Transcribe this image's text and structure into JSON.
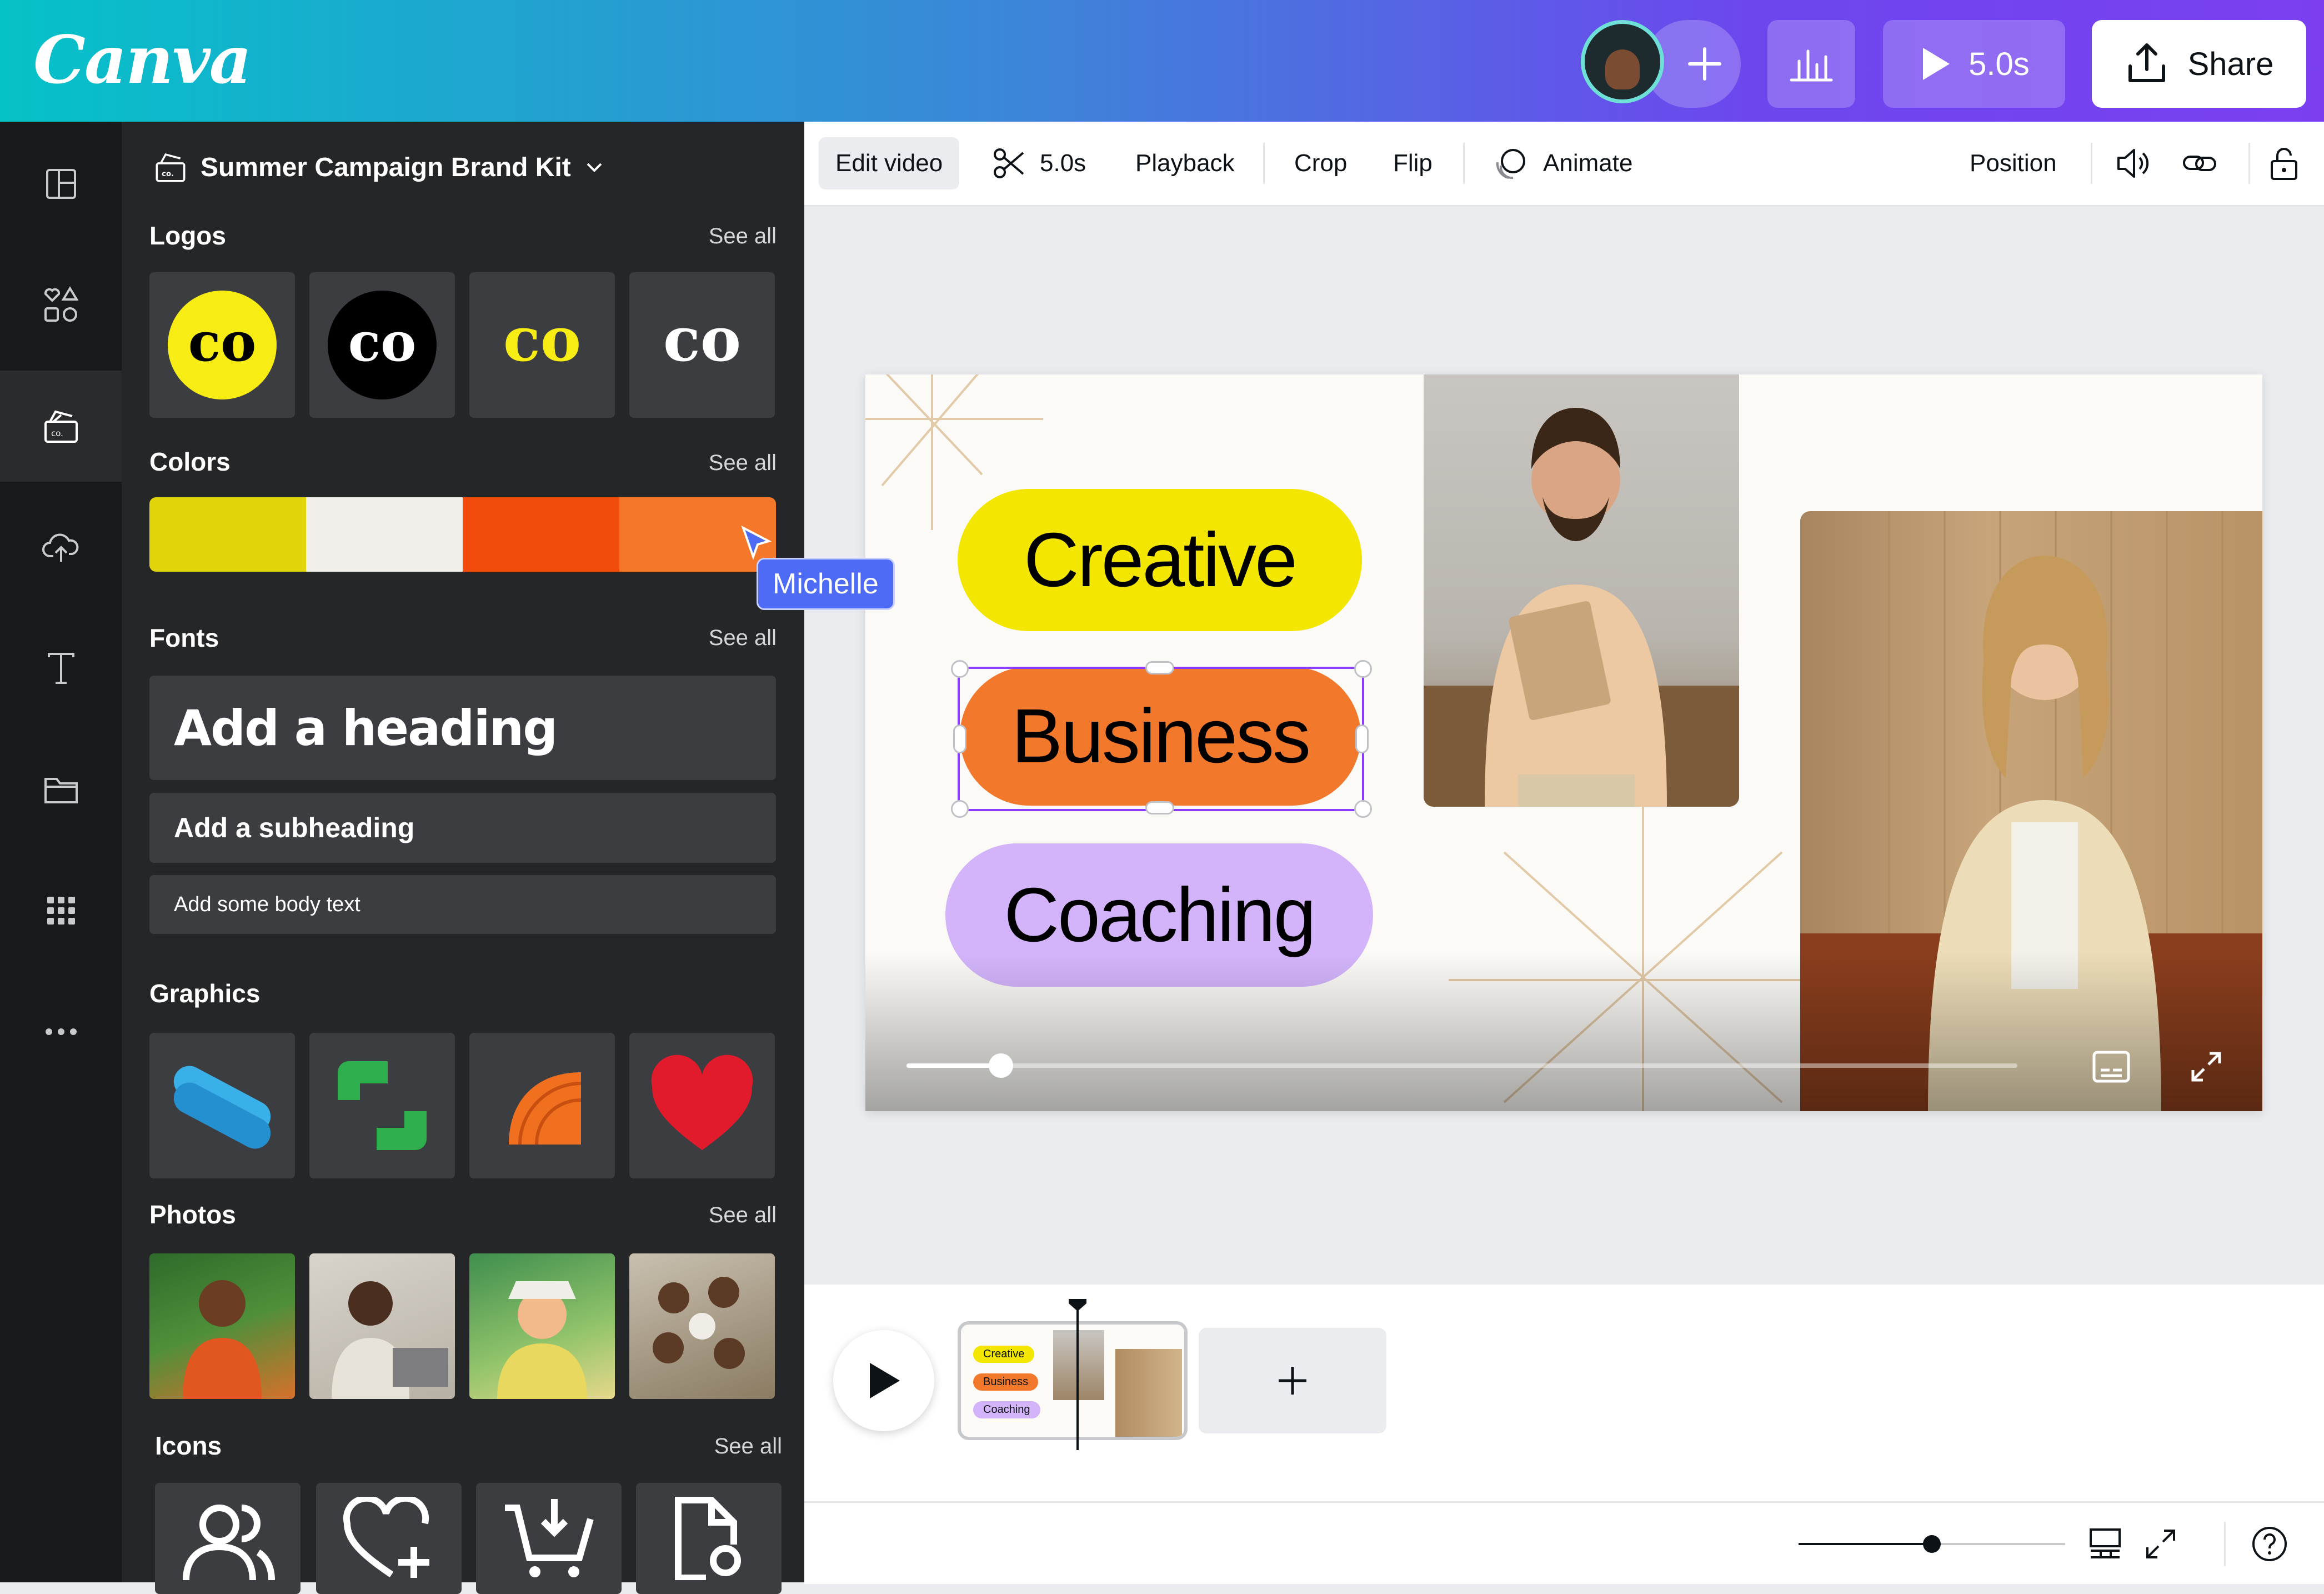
{
  "app": {
    "logo": "Canva"
  },
  "topbar": {
    "duration": "5.0s",
    "share_label": "Share",
    "colors": {
      "gradient_start": "#05c2c8",
      "gradient_end": "#7b3ff1"
    }
  },
  "rail": {
    "items": [
      {
        "icon": "layout-icon"
      },
      {
        "icon": "elements-icon"
      },
      {
        "icon": "brand-icon"
      },
      {
        "icon": "upload-icon"
      },
      {
        "icon": "text-icon"
      },
      {
        "icon": "folder-icon"
      },
      {
        "icon": "apps-icon"
      },
      {
        "icon": "more-icon"
      }
    ]
  },
  "panel": {
    "kit_name": "Summer Campaign Brand Kit",
    "logos": {
      "label": "Logos",
      "see_all": "See all"
    },
    "colors": {
      "label": "Colors",
      "see_all": "See all",
      "swatches": [
        "#e1d40a",
        "#f0efe9",
        "#f24c0c",
        "#f5782a"
      ]
    },
    "fonts": {
      "label": "Fonts",
      "see_all": "See all",
      "heading": "Add a heading",
      "subheading": "Add a subheading",
      "body": "Add some body text"
    },
    "graphics": {
      "label": "Graphics"
    },
    "photos": {
      "label": "Photos",
      "see_all": "See all"
    },
    "icons": {
      "label": "Icons",
      "see_all": "See all"
    }
  },
  "collaborator_cursor": {
    "name": "Michelle"
  },
  "context_toolbar": {
    "edit_video": "Edit video",
    "trim_duration": "5.0s",
    "playback": "Playback",
    "crop": "Crop",
    "flip": "Flip",
    "animate": "Animate",
    "position": "Position"
  },
  "slide": {
    "pills": [
      {
        "text": "Creative",
        "color": "#f3e600"
      },
      {
        "text": "Business",
        "color": "#f2782b"
      },
      {
        "text": "Coaching",
        "color": "#d3b4fb"
      }
    ],
    "video_progress": 0.085
  },
  "timeline": {
    "thumb_labels": [
      "Creative",
      "Business",
      "Coaching"
    ]
  }
}
